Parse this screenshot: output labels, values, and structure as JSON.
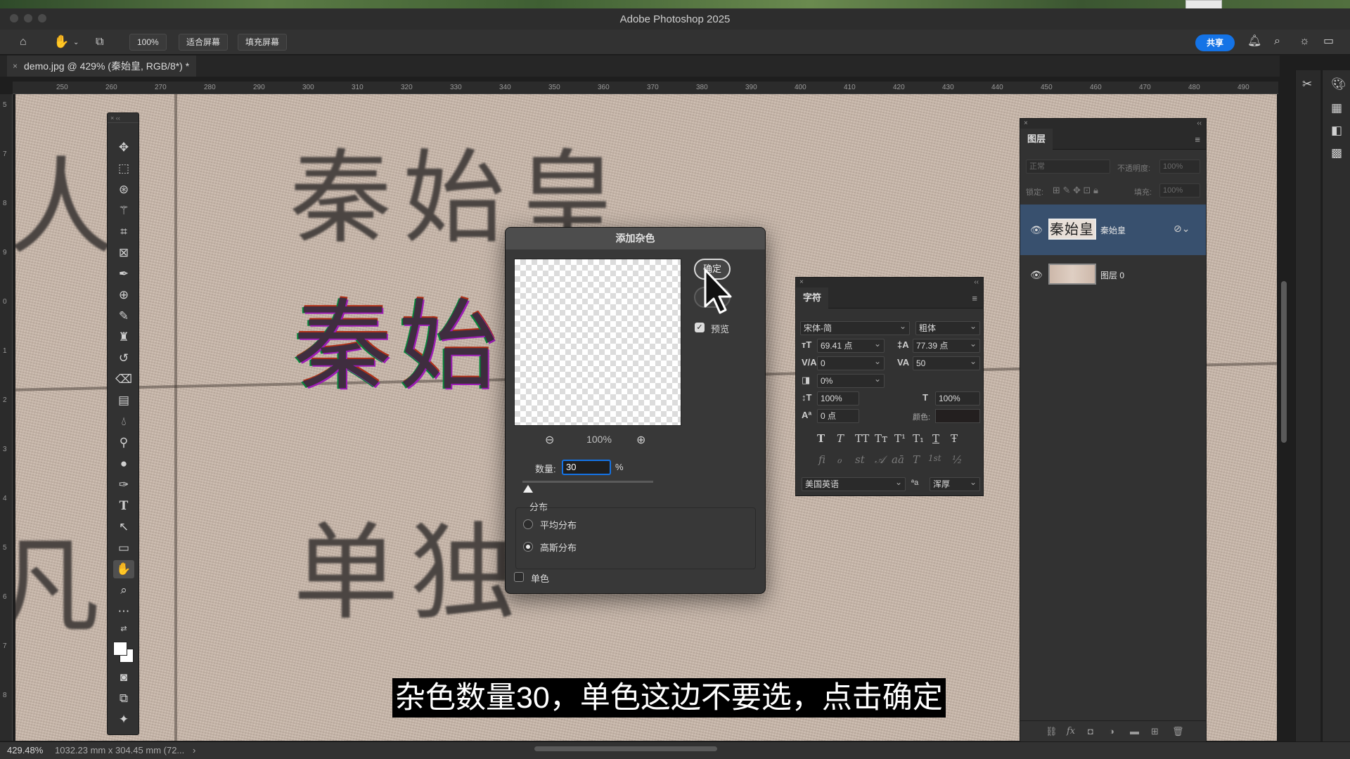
{
  "app": {
    "title": "Adobe Photoshop 2025"
  },
  "options_bar": {
    "zoom": "100%",
    "fit_screen": "适合屏幕",
    "fill_screen": "填充屏幕",
    "share": "共享"
  },
  "document": {
    "tab_title": "demo.jpg @ 429% (秦始皇, RGB/8*) *",
    "close_glyph": "×"
  },
  "rulers": {
    "h_ticks": [
      "250",
      "260",
      "270",
      "280",
      "290",
      "300",
      "310",
      "320",
      "330",
      "340",
      "350",
      "360",
      "370",
      "380",
      "390",
      "400",
      "410",
      "420",
      "430",
      "440",
      "450",
      "460",
      "470",
      "480",
      "490"
    ],
    "v_ticks": [
      "5",
      "7",
      "8",
      "9",
      "0",
      "1",
      "2",
      "3",
      "4",
      "5",
      "6",
      "7",
      "8"
    ]
  },
  "canvas": {
    "line1": "秦始皇",
    "line2": "秦始",
    "line3": "单独",
    "edge_left_top": "人",
    "edge_left_bottom": "凡"
  },
  "dialog": {
    "title": "添加杂色",
    "ok": "确定",
    "cancel": "取消",
    "preview_label": "预览",
    "preview_checked": true,
    "zoom": "100%",
    "amount_label": "数量:",
    "amount_value": "30",
    "amount_unit": "%",
    "amount_fraction": 0.3,
    "distribution_label": "分布",
    "uniform": "平均分布",
    "gaussian": "高斯分布",
    "selected_distribution": "gaussian",
    "monochromatic": "单色",
    "monochromatic_checked": false
  },
  "character_panel": {
    "tab": "字符",
    "font_family": "宋体-简",
    "font_style": "粗体",
    "font_size": "69.41 点",
    "leading": "77.39 点",
    "kerning": "0",
    "tracking": "50",
    "tsume": "0%",
    "vertical_scale": "100%",
    "horizontal_scale": "100%",
    "baseline_shift": "0 点",
    "color_label": "颜色:",
    "language": "美国英语",
    "antialias": "浑厚",
    "antialias_prefix": "ªa",
    "style_buttons": [
      "T",
      "T",
      "TT",
      "Tт",
      "T¹",
      "T₁",
      "T",
      "Ŧ"
    ],
    "opentype_buttons": [
      "fi",
      "ℴ",
      "st",
      "𝒜",
      "aā",
      "T",
      "1st",
      "½"
    ]
  },
  "layers_panel": {
    "tab": "图层",
    "blend_mode": "正常",
    "opacity_label": "不透明度:",
    "opacity": "100%",
    "lock_label": "锁定:",
    "fill_label": "填充:",
    "fill": "100%",
    "layers": [
      {
        "name": "秦始皇",
        "thumb_text": "秦始皇",
        "selected": true
      },
      {
        "name": "图层 0",
        "thumb_text": "",
        "selected": false
      }
    ]
  },
  "status_bar": {
    "zoom": "429.48%",
    "doc_info": "1032.23 mm x 304.45 mm (72...",
    "arrow": "›"
  },
  "subtitle": "杂色数量30，单色这边不要选，点击确定",
  "colors": {
    "accent": "#1473e6",
    "selected_layer": "#38506e",
    "panel_bg": "#323232",
    "app_bg": "#1e1e1e"
  }
}
